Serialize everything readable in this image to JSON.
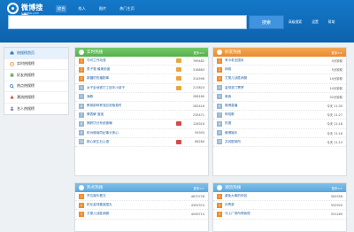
{
  "header": {
    "logo_title": "微博搜索",
    "logo_sub": "s.weibo.com",
    "nav": [
      "综合",
      "找人",
      "图片",
      "热门主页"
    ],
    "search_placeholder": "",
    "search_button": "搜索",
    "links": [
      "高级搜索",
      "设置",
      "帮助"
    ]
  },
  "sidebar": {
    "items": [
      {
        "label": "热搜榜首页",
        "icon": "home-icon",
        "active": true
      },
      {
        "label": "实时热搜榜",
        "icon": "clock-icon",
        "active": false
      },
      {
        "label": "好友热搜榜",
        "icon": "friends-icon",
        "active": false
      },
      {
        "label": "热点热搜榜",
        "icon": "search-icon",
        "active": false
      },
      {
        "label": "潮流热搜榜",
        "icon": "trend-icon",
        "active": false
      },
      {
        "label": "名人热搜榜",
        "icon": "person-icon",
        "active": false
      }
    ]
  },
  "panels": {
    "realtime": {
      "title": "实时热搜",
      "more": "更多>>",
      "rows": [
        {
          "rank": "1",
          "title": "马可兰丹动漫",
          "badge": "b1",
          "value": "769482"
        },
        {
          "rank": "2",
          "title": "男子毫·最美前度",
          "badge": "b1",
          "value": "318683"
        },
        {
          "rank": "3",
          "title": "新疆的热播剧事",
          "badge": "b1",
          "value": "314596"
        },
        {
          "rank": "4",
          "title": "女子坐地铁打工回丰小孩子",
          "badge": "b1",
          "value": "213824"
        },
        {
          "rank": "5",
          "title": "海豚",
          "badge": "",
          "value": "286180"
        },
        {
          "rank": "6",
          "title": "教育部称养宠应收取费时",
          "badge": "",
          "value": "282416"
        },
        {
          "rank": "7",
          "title": "情表解 落遗",
          "badge": "",
          "value": "235471"
        },
        {
          "rank": "8",
          "title": "捕获坊分系统被曝",
          "badge": "b2",
          "value": "126316"
        },
        {
          "rank": "9",
          "title": "杭州微商同纪事头条心",
          "badge": "",
          "value": "95393"
        },
        {
          "rank": "10",
          "title": "那心新生石心语",
          "badge": "b2",
          "value": "86284"
        }
      ]
    },
    "friends": {
      "title": "好友热搜",
      "more": "更多>>",
      "rows": [
        {
          "rank": "1",
          "title": "有今老全国米",
          "badge": "",
          "value": "4分钟前"
        },
        {
          "rank": "2",
          "title": "网络",
          "badge": "",
          "value": "5分钟前"
        },
        {
          "rank": "3",
          "title": "艾丽儿战胜病魔",
          "badge": "",
          "value": "14分钟前"
        },
        {
          "rank": "4",
          "title": "金球奖门票罗",
          "badge": "",
          "value": "14分钟前"
        },
        {
          "rank": "5",
          "title": "美食",
          "badge": "",
          "value": "32分钟前"
        },
        {
          "rank": "6",
          "title": "微博直播",
          "badge": "",
          "value": "今天 11:30"
        },
        {
          "rank": "7",
          "title": "阿啦歌",
          "badge": "",
          "value": "今天 11:27"
        },
        {
          "rank": "8",
          "title": "热搜",
          "badge": "",
          "value": "今天 11:18"
        },
        {
          "rank": "9",
          "title": "微博娱乐",
          "badge": "",
          "value": "今天 11:16"
        },
        {
          "rank": "10",
          "title": "井冈剧场所",
          "badge": "",
          "value": "今天 11:10"
        }
      ]
    },
    "hotspot": {
      "title": "热点热搜",
      "more": "更多>>",
      "rows": [
        {
          "rank": "1",
          "title": "齐位娱乐看文",
          "badge": "",
          "value": "4870728"
        },
        {
          "rank": "2",
          "title": "杭化金球奏赢国丸",
          "badge": "",
          "value": "4392374"
        },
        {
          "rank": "3",
          "title": "艾丽儿战胜病魔",
          "badge": "",
          "value": "4049714"
        }
      ]
    },
    "trend": {
      "title": "潮流热搜",
      "more": "更多>>",
      "rows": [
        {
          "rank": "1",
          "title": "避免大事的伴侣",
          "badge": "",
          "value": "561558"
        },
        {
          "rank": "2",
          "title": "孙青菜",
          "badge": "",
          "value": "552920"
        },
        {
          "rank": "3",
          "title": "马上广场所得我很",
          "badge": "",
          "value": "551269"
        }
      ]
    }
  },
  "colors": {
    "brand": "#0d62ad",
    "hot_rank": "#f08c2e",
    "link": "#2864a5"
  }
}
